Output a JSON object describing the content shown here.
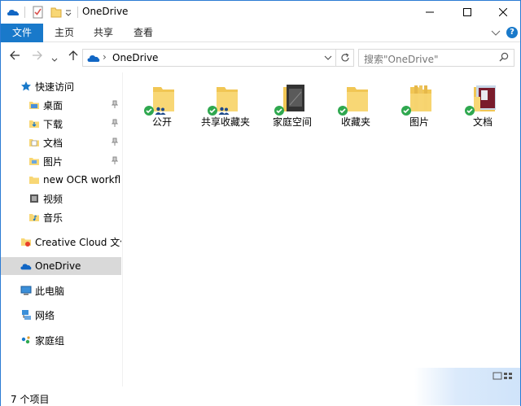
{
  "window": {
    "title": "OneDrive"
  },
  "ribbon": {
    "tabs": [
      {
        "label": "文件"
      },
      {
        "label": "主页"
      },
      {
        "label": "共享"
      },
      {
        "label": "查看"
      }
    ]
  },
  "address": {
    "path": "OneDrive",
    "separator": "›"
  },
  "search": {
    "placeholder": "搜索\"OneDrive\""
  },
  "nav": {
    "quick_access": "快速访问",
    "items": [
      {
        "label": "桌面",
        "pinned": true
      },
      {
        "label": "下载",
        "pinned": true
      },
      {
        "label": "文档",
        "pinned": true
      },
      {
        "label": "图片",
        "pinned": true
      },
      {
        "label": "new OCR workflow",
        "pinned": false
      },
      {
        "label": "视频",
        "pinned": false
      },
      {
        "label": "音乐",
        "pinned": false
      }
    ],
    "creative_cloud": "Creative Cloud 文件",
    "onedrive": "OneDrive",
    "this_pc": "此电脑",
    "network": "网络",
    "homegroup": "家庭组"
  },
  "folders": [
    {
      "label": "公开",
      "shared": true,
      "thumb": "plain"
    },
    {
      "label": "共享收藏夹",
      "shared": true,
      "thumb": "plain"
    },
    {
      "label": "家庭空间",
      "shared": false,
      "thumb": "dark"
    },
    {
      "label": "收藏夹",
      "shared": false,
      "thumb": "plain"
    },
    {
      "label": "图片",
      "shared": false,
      "thumb": "pictures"
    },
    {
      "label": "文档",
      "shared": false,
      "thumb": "docs"
    }
  ],
  "status": {
    "item_count": "7 个项目"
  },
  "colors": {
    "accent": "#1979ca",
    "folder": "#f8d775",
    "sync_ok": "#2fa84f",
    "selected_bg": "#d9d9d9"
  }
}
